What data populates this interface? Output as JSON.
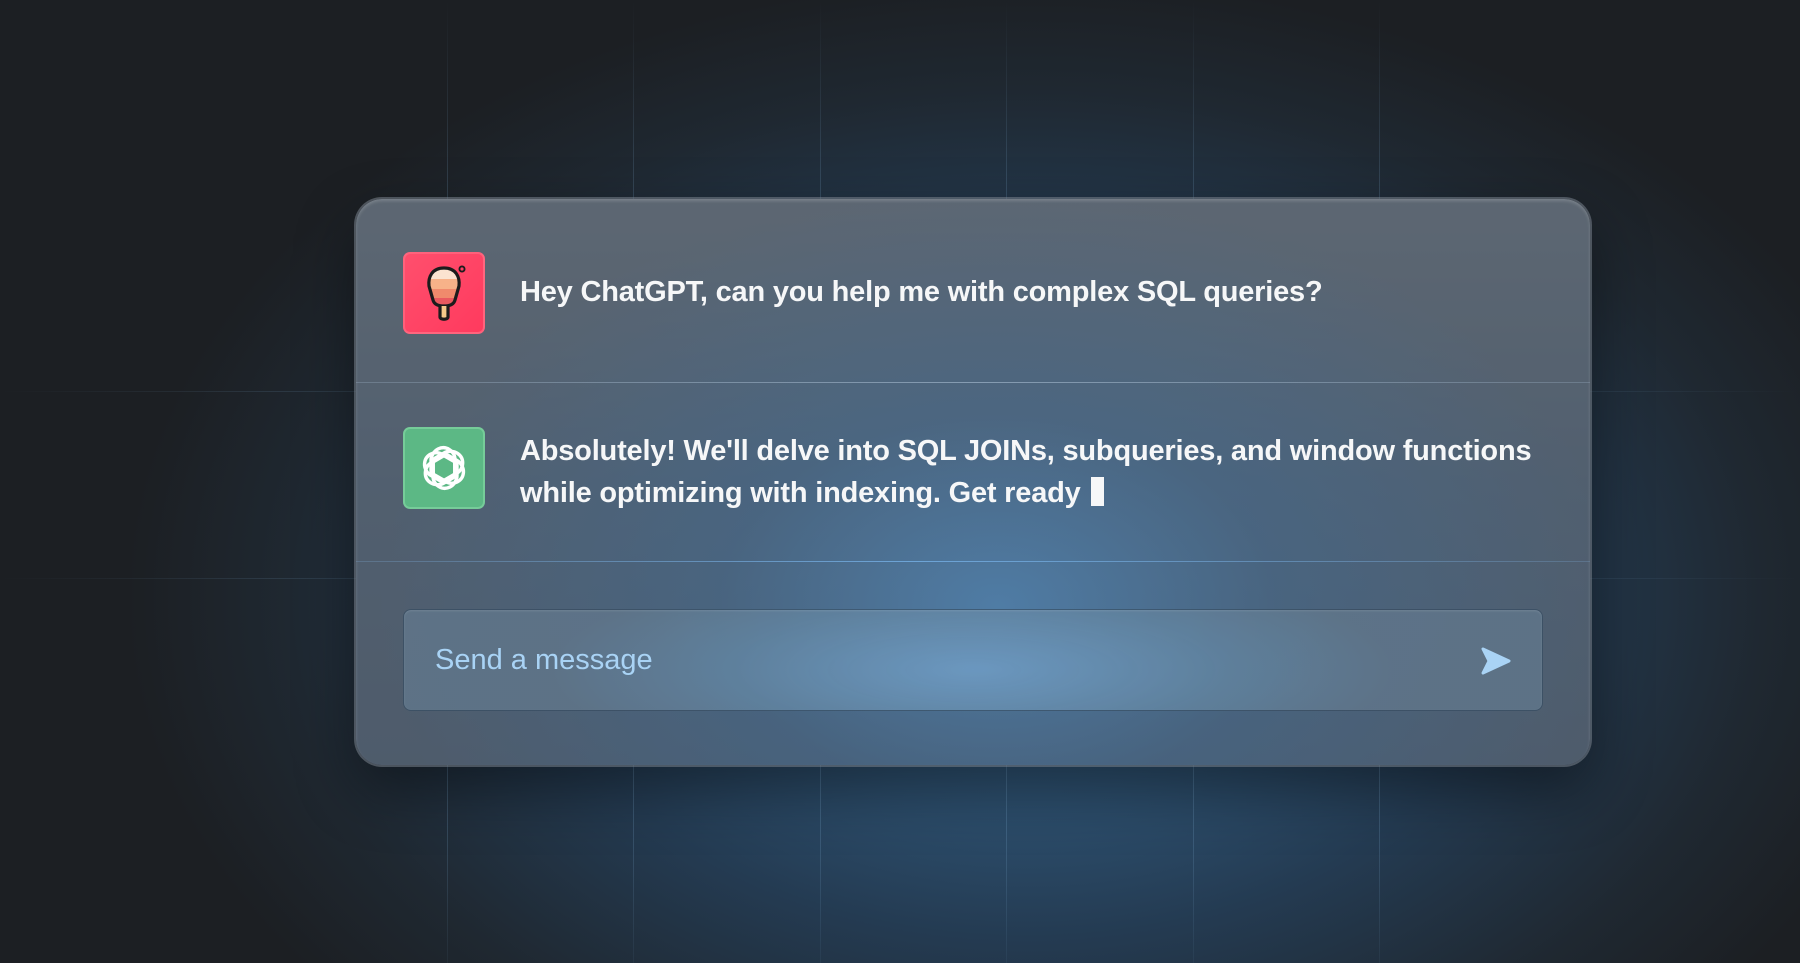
{
  "chat": {
    "user_message": "Hey ChatGPT, can you help me with complex SQL queries?",
    "assistant_message": "Absolutely! We'll delve into SQL JOINs, subqueries, and window functions while optimizing with indexing. Get ready"
  },
  "composer": {
    "placeholder": "Send a message",
    "value": ""
  },
  "icons": {
    "user_avatar": "popsicle-icon",
    "assistant_avatar": "openai-logo-icon",
    "send": "send-arrow-icon"
  },
  "colors": {
    "user_avatar_bg": "#ff4066",
    "assistant_avatar_bg": "#5cb885",
    "placeholder_text": "#a9d3f5",
    "message_text": "#f6f7f8"
  }
}
